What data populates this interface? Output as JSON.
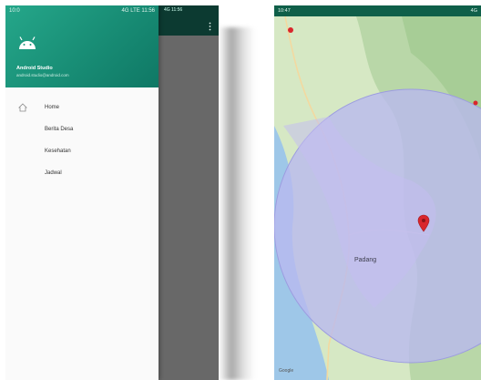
{
  "left_screen": {
    "statusbar": {
      "time": "10:0",
      "right": "4G LTE 11:56"
    },
    "drawer": {
      "title": "Android Studio",
      "subtitle": "android.studio@android.com",
      "items": [
        {
          "label": "Home",
          "icon": "home-icon"
        },
        {
          "label": "Berita Desa",
          "icon": ""
        },
        {
          "label": "Kesehatan",
          "icon": ""
        },
        {
          "label": "Jadwal",
          "icon": ""
        }
      ]
    },
    "app_bar": {
      "status": "4G 11:56",
      "overflow_icon": "more-vert-icon"
    },
    "colors": {
      "primary": "#1a9478",
      "primary_dark": "#0c3a31",
      "scrim": "#686868"
    }
  },
  "right_screen": {
    "statusbar": {
      "left": "10:47",
      "right": "4G"
    },
    "map": {
      "place_label": "Padang",
      "marker_color": "#d9262c",
      "radius_fill": "#b8b8f0",
      "attribution": "Google"
    }
  }
}
